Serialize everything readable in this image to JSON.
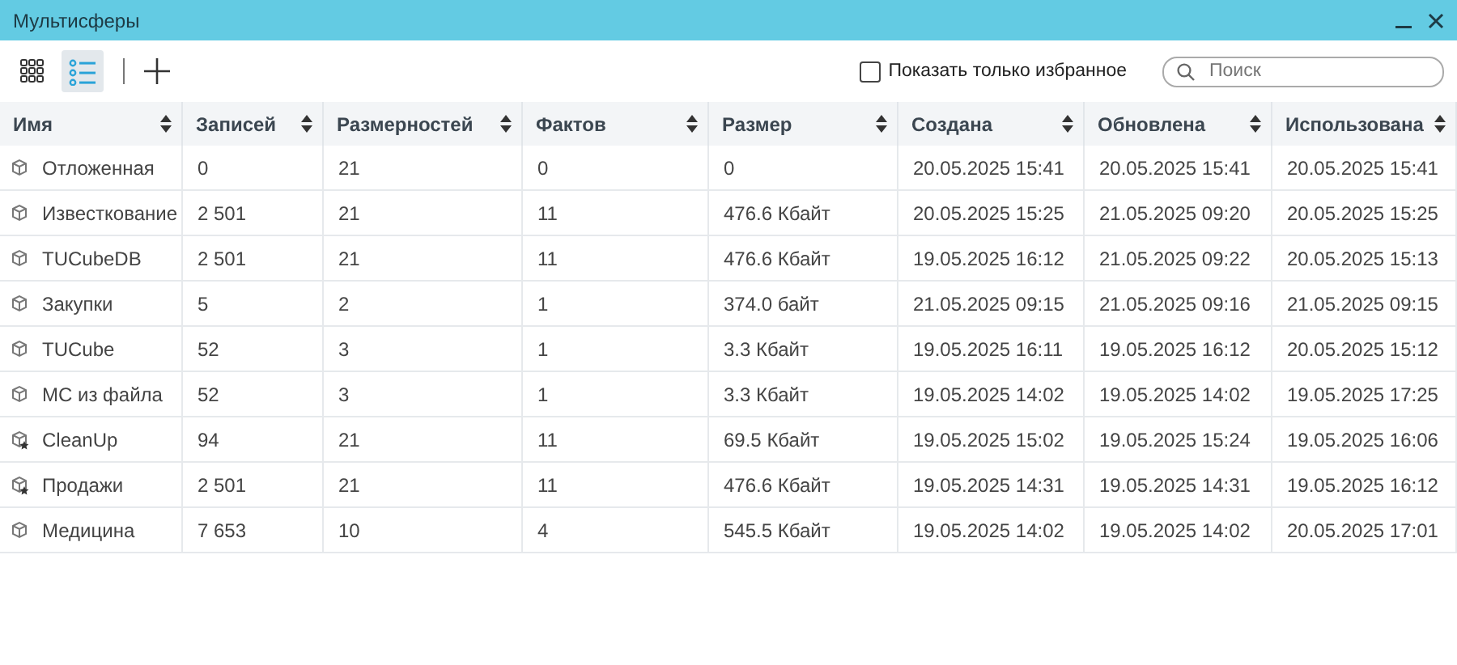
{
  "window": {
    "title": "Мультисферы"
  },
  "toolbar": {
    "views": [
      {
        "kind": "tiles",
        "selected": false
      },
      {
        "kind": "list",
        "selected": true
      }
    ],
    "favorites_only": {
      "label": "Показать только избранное",
      "checked": false
    },
    "search": {
      "placeholder": "Поиск"
    }
  },
  "table": {
    "columns": [
      "Имя",
      "Записей",
      "Размерностей",
      "Фактов",
      "Размер",
      "Создана",
      "Обновлена",
      "Использована"
    ],
    "rows": [
      {
        "favorite": false,
        "cells": [
          "Отложенная",
          "0",
          "21",
          "0",
          "0",
          "20.05.2025 15:41",
          "20.05.2025 15:41",
          "20.05.2025 15:41"
        ]
      },
      {
        "favorite": false,
        "cells": [
          "Известкование",
          "2 501",
          "21",
          "11",
          "476.6 Кбайт",
          "20.05.2025 15:25",
          "21.05.2025 09:20",
          "20.05.2025 15:25"
        ]
      },
      {
        "favorite": false,
        "cells": [
          "TUCubeDB",
          "2 501",
          "21",
          "11",
          "476.6 Кбайт",
          "19.05.2025 16:12",
          "21.05.2025 09:22",
          "20.05.2025 15:13"
        ]
      },
      {
        "favorite": false,
        "cells": [
          "Закупки",
          "5",
          "2",
          "1",
          "374.0 байт",
          "21.05.2025 09:15",
          "21.05.2025 09:16",
          "21.05.2025 09:15"
        ]
      },
      {
        "favorite": false,
        "cells": [
          "TUCube",
          "52",
          "3",
          "1",
          "3.3 Кбайт",
          "19.05.2025 16:11",
          "19.05.2025 16:12",
          "20.05.2025 15:12"
        ]
      },
      {
        "favorite": false,
        "cells": [
          "МС из файла",
          "52",
          "3",
          "1",
          "3.3 Кбайт",
          "19.05.2025 14:02",
          "19.05.2025 14:02",
          "19.05.2025 17:25"
        ]
      },
      {
        "favorite": true,
        "cells": [
          "CleanUp",
          "94",
          "21",
          "11",
          "69.5 Кбайт",
          "19.05.2025 15:02",
          "19.05.2025 15:24",
          "19.05.2025 16:06"
        ]
      },
      {
        "favorite": true,
        "cells": [
          "Продажи",
          "2 501",
          "21",
          "11",
          "476.6 Кбайт",
          "19.05.2025 14:31",
          "19.05.2025 14:31",
          "19.05.2025 16:12"
        ]
      },
      {
        "favorite": false,
        "cells": [
          "Медицина",
          "7 653",
          "10",
          "4",
          "545.5 Кбайт",
          "19.05.2025 14:02",
          "19.05.2025 14:02",
          "20.05.2025 17:01"
        ]
      }
    ]
  }
}
